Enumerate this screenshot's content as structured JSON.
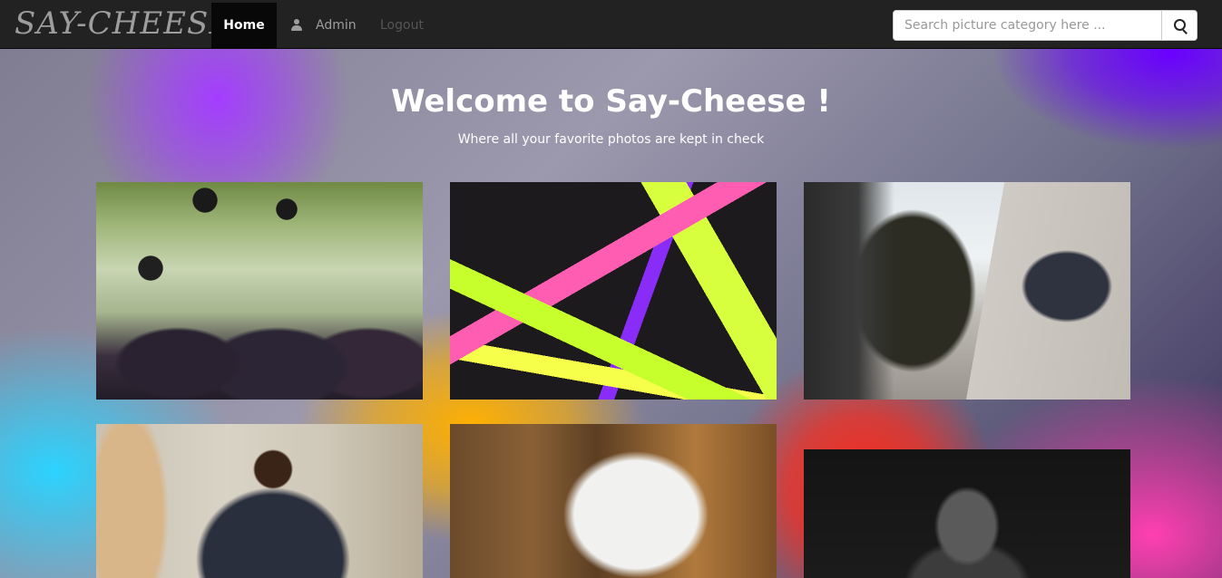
{
  "navbar": {
    "brand": "SAY-CHEESE",
    "home_label": "Home",
    "admin_label": "Admin",
    "logout_label": "Logout",
    "search_placeholder": "Search picture category here ..."
  },
  "hero": {
    "title_prefix": "Welcome to ",
    "title_brand": "Say-Cheese !",
    "subtitle": "Where all your favorite photos are kept in check"
  },
  "photos": [
    {
      "subject": "graduation-caps-toss"
    },
    {
      "subject": "sticky-notes-and-markers"
    },
    {
      "subject": "business-meeting"
    },
    {
      "subject": "man-at-desk"
    },
    {
      "subject": "white-robot"
    },
    {
      "subject": "person-covering-face"
    }
  ]
}
